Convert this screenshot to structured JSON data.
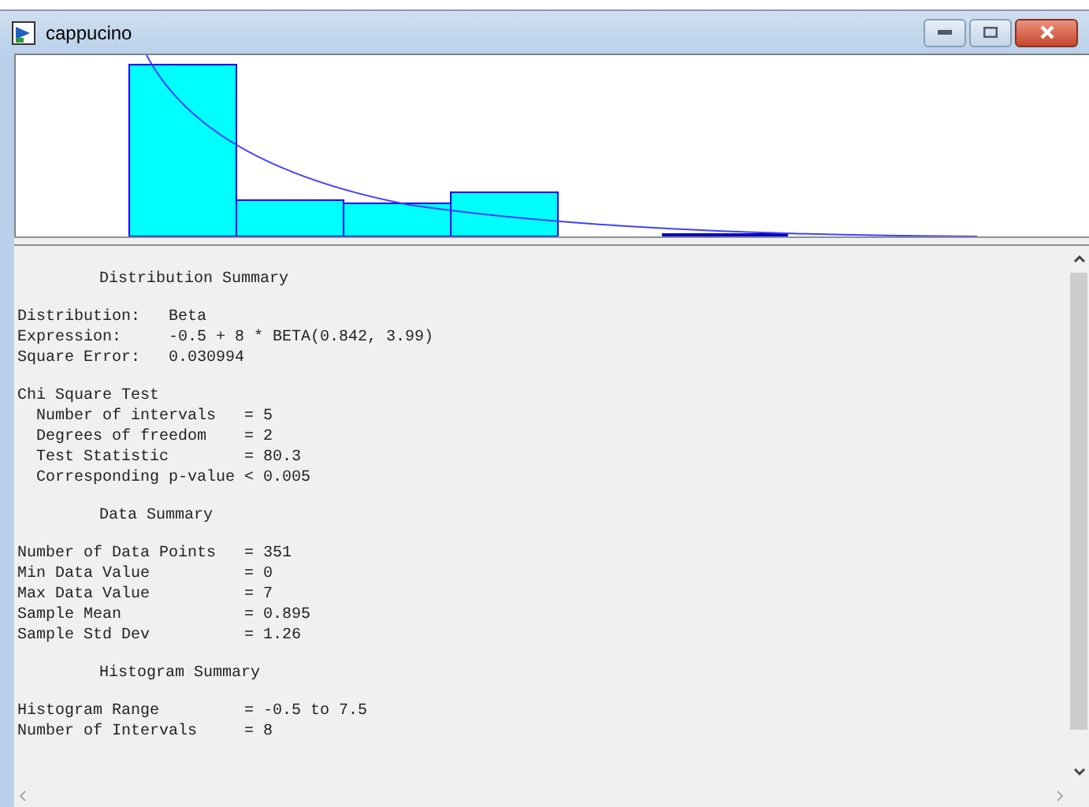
{
  "window": {
    "title": "cappucino"
  },
  "report": {
    "lines": [
      {
        "kind": "blank"
      },
      {
        "kind": "heading",
        "text": "Distribution Summary"
      },
      {
        "kind": "blank"
      },
      {
        "kind": "text",
        "text": "Distribution:   Beta"
      },
      {
        "kind": "text",
        "text": "Expression:     -0.5 + 8 * BETA(0.842, 3.99)"
      },
      {
        "kind": "text",
        "text": "Square Error:   0.030994"
      },
      {
        "kind": "blank"
      },
      {
        "kind": "text",
        "text": "Chi Square Test"
      },
      {
        "kind": "text",
        "text": "  Number of intervals   = 5"
      },
      {
        "kind": "text",
        "text": "  Degrees of freedom    = 2"
      },
      {
        "kind": "text",
        "text": "  Test Statistic        = 80.3"
      },
      {
        "kind": "text",
        "text": "  Corresponding p-value < 0.005"
      },
      {
        "kind": "blank"
      },
      {
        "kind": "heading",
        "text": "Data Summary"
      },
      {
        "kind": "blank"
      },
      {
        "kind": "text",
        "text": "Number of Data Points   = 351"
      },
      {
        "kind": "text",
        "text": "Min Data Value          = 0"
      },
      {
        "kind": "text",
        "text": "Max Data Value          = 7"
      },
      {
        "kind": "text",
        "text": "Sample Mean             = 0.895"
      },
      {
        "kind": "text",
        "text": "Sample Std Dev          = 1.26"
      },
      {
        "kind": "blank"
      },
      {
        "kind": "heading",
        "text": "Histogram Summary"
      },
      {
        "kind": "blank"
      },
      {
        "kind": "text",
        "text": "Histogram Range         = -0.5 to 7.5"
      },
      {
        "kind": "text",
        "text": "Number of Intervals     = 8"
      }
    ]
  }
}
